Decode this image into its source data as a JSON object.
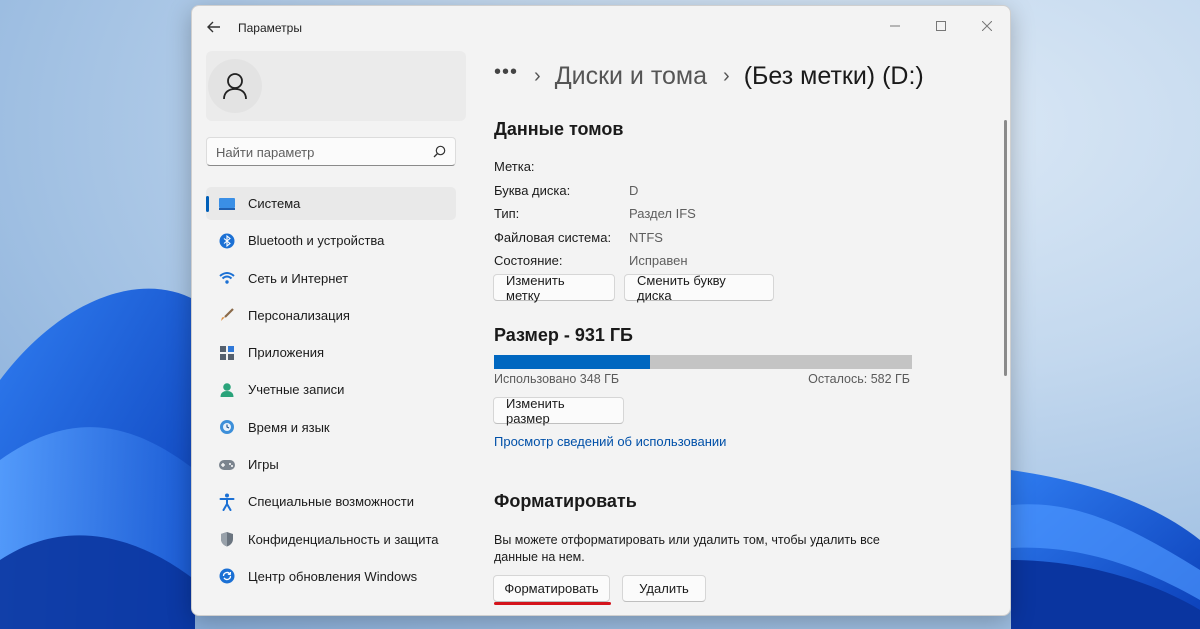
{
  "window": {
    "title": "Параметры"
  },
  "sidebar": {
    "search_placeholder": "Найти параметр",
    "items": [
      {
        "label": "Система",
        "icon": "system-icon",
        "active": true
      },
      {
        "label": "Bluetooth и устройства",
        "icon": "bluetooth-icon"
      },
      {
        "label": "Сеть и Интернет",
        "icon": "wifi-icon"
      },
      {
        "label": "Персонализация",
        "icon": "brush-icon"
      },
      {
        "label": "Приложения",
        "icon": "apps-icon"
      },
      {
        "label": "Учетные записи",
        "icon": "account-icon"
      },
      {
        "label": "Время и язык",
        "icon": "globe-clock-icon"
      },
      {
        "label": "Игры",
        "icon": "gamepad-icon"
      },
      {
        "label": "Специальные возможности",
        "icon": "accessibility-icon"
      },
      {
        "label": "Конфиденциальность и защита",
        "icon": "shield-icon"
      },
      {
        "label": "Центр обновления Windows",
        "icon": "update-icon"
      }
    ]
  },
  "breadcrumb": {
    "dots": "•••",
    "parent": "Диски и тома",
    "current": "(Без метки) (D:)"
  },
  "volume": {
    "title": "Данные томов",
    "props": [
      {
        "label": "Метка:",
        "value": ""
      },
      {
        "label": "Буква диска:",
        "value": "D"
      },
      {
        "label": "Тип:",
        "value": "Раздел IFS"
      },
      {
        "label": "Файловая система:",
        "value": "NTFS"
      },
      {
        "label": "Состояние:",
        "value": "Исправен"
      }
    ],
    "change_label_button": "Изменить метку",
    "change_letter_button": "Сменить букву диска"
  },
  "size": {
    "title": "Размер - 931 ГБ",
    "used_fraction": 0.374,
    "used_text": "Использовано 348 ГБ",
    "free_text": "Осталось: 582 ГБ",
    "resize_button": "Изменить размер",
    "usage_link": "Просмотр сведений об использовании"
  },
  "format": {
    "title": "Форматировать",
    "description": "Вы можете отформатировать или удалить том, чтобы удалить все данные на нем.",
    "format_button": "Форматировать",
    "delete_button": "Удалить"
  },
  "colors": {
    "accent": "#005fb8",
    "progress_fill": "#0067c0",
    "highlight_underline": "#d4131b"
  }
}
